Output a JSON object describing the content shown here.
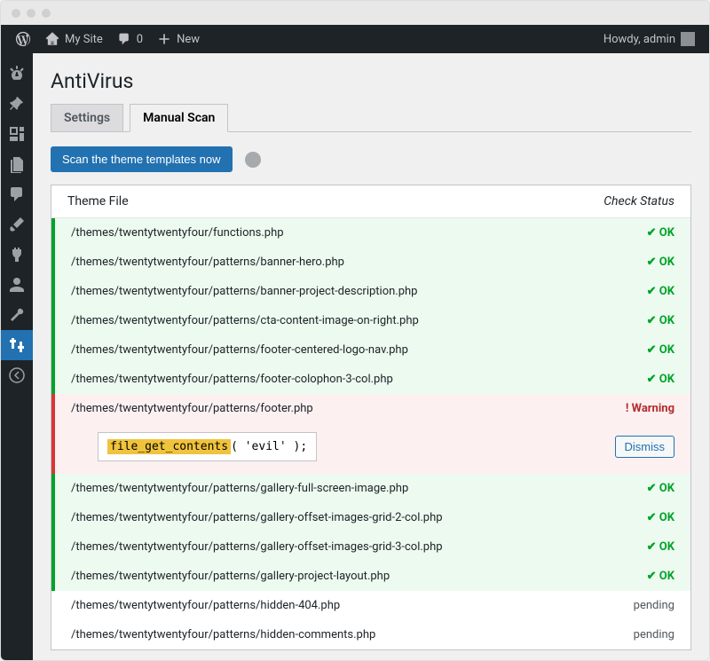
{
  "admin_bar": {
    "site_name": "My Site",
    "comments_count": "0",
    "new_label": "New",
    "greeting": "Howdy, admin"
  },
  "sidebar": {
    "items": [
      {
        "icon": "dashboard"
      },
      {
        "icon": "pin"
      },
      {
        "icon": "media"
      },
      {
        "icon": "pages"
      },
      {
        "icon": "comment"
      },
      {
        "icon": "brush"
      },
      {
        "icon": "plugins"
      },
      {
        "icon": "users"
      },
      {
        "icon": "tools"
      },
      {
        "icon": "sliders",
        "current": true
      },
      {
        "icon": "collapse"
      }
    ]
  },
  "page": {
    "title": "AntiVirus",
    "tabs": [
      {
        "label": "Settings",
        "active": false
      },
      {
        "label": "Manual Scan",
        "active": true
      }
    ],
    "scan_button": "Scan the theme templates now"
  },
  "results": {
    "col_file": "Theme File",
    "col_status": "Check Status",
    "dismiss_label": "Dismiss",
    "rows": [
      {
        "path": "/themes/twentytwentyfour/functions.php",
        "status": "ok"
      },
      {
        "path": "/themes/twentytwentyfour/patterns/banner-hero.php",
        "status": "ok"
      },
      {
        "path": "/themes/twentytwentyfour/patterns/banner-project-description.php",
        "status": "ok"
      },
      {
        "path": "/themes/twentytwentyfour/patterns/cta-content-image-on-right.php",
        "status": "ok"
      },
      {
        "path": "/themes/twentytwentyfour/patterns/footer-centered-logo-nav.php",
        "status": "ok"
      },
      {
        "path": "/themes/twentytwentyfour/patterns/footer-colophon-3-col.php",
        "status": "ok"
      },
      {
        "path": "/themes/twentytwentyfour/patterns/footer.php",
        "status": "warning",
        "code_highlight": "file_get_contents",
        "code_rest": "( 'evil' );"
      },
      {
        "path": "/themes/twentytwentyfour/patterns/gallery-full-screen-image.php",
        "status": "ok"
      },
      {
        "path": "/themes/twentytwentyfour/patterns/gallery-offset-images-grid-2-col.php",
        "status": "ok"
      },
      {
        "path": "/themes/twentytwentyfour/patterns/gallery-offset-images-grid-3-col.php",
        "status": "ok"
      },
      {
        "path": "/themes/twentytwentyfour/patterns/gallery-project-layout.php",
        "status": "ok"
      },
      {
        "path": "/themes/twentytwentyfour/patterns/hidden-404.php",
        "status": "pending"
      },
      {
        "path": "/themes/twentytwentyfour/patterns/hidden-comments.php",
        "status": "pending"
      }
    ],
    "status_labels": {
      "ok": "✔ OK",
      "warning": "! Warning",
      "pending": "pending"
    }
  }
}
